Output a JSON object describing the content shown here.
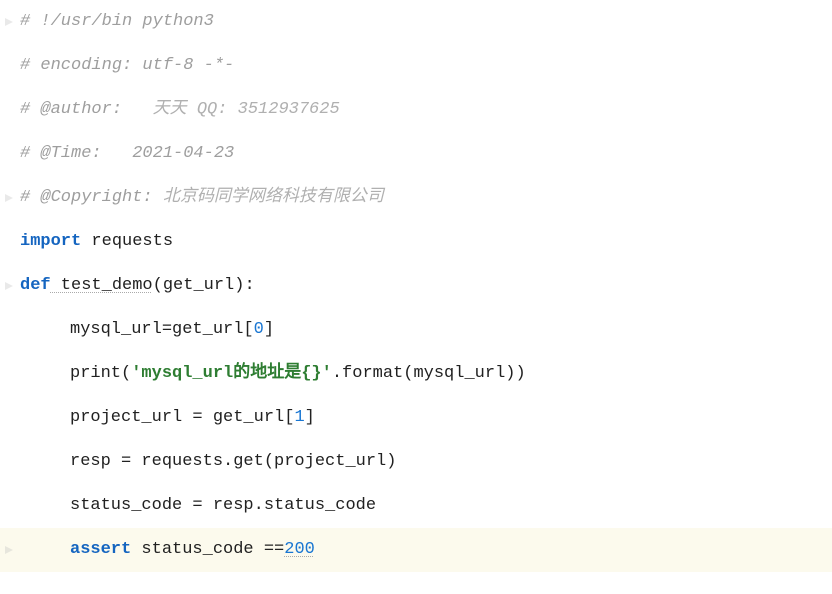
{
  "code": {
    "lines": {
      "shebang": "# !/usr/bin python3",
      "encoding": "# encoding: utf-8 -*-",
      "author_lbl": "# @author:   ",
      "author_val": "天天 QQ: 3512937625",
      "time_lbl": "# @Time:   ",
      "time_val": "2021-04-23",
      "copy_lbl": "# @Copyright: ",
      "copy_val": "北京码同学网络科技有限公司",
      "import_kw": "import",
      "import_mod": " requests",
      "def_kw": "def",
      "def_name": " test_demo",
      "def_args": "(get_url):",
      "l1": "mysql_url=get_url[",
      "l1_idx": "0",
      "l1_end": "]",
      "l2a": "print(",
      "l2_str": "'mysql_url的地址是{}'",
      "l2b": ".format(mysql_url))",
      "l3a": "project_url = get_url[",
      "l3_idx": "1",
      "l3b": "]",
      "l4": "resp = requests.get(project_url)",
      "l5": "status_code = resp.status_code",
      "l6_kw": "assert",
      "l6_txt": " status_code ==",
      "l6_num": "200"
    }
  }
}
